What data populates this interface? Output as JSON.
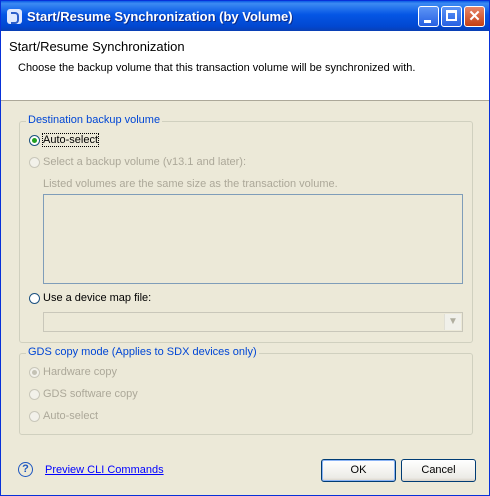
{
  "window": {
    "title": "Start/Resume Synchronization (by Volume)",
    "controls": {
      "minimize": "minimize-icon",
      "maximize": "maximize-icon",
      "close": "close-icon",
      "close_glyph": "✕"
    }
  },
  "header": {
    "title": "Start/Resume Synchronization",
    "description": "Choose the backup volume that this transaction volume will be synchronized with."
  },
  "destination": {
    "legend": "Destination backup volume",
    "auto_select": {
      "label": "Auto-select",
      "selected": true,
      "enabled": true
    },
    "select_backup": {
      "label": "Select a backup volume (v13.1 and later):",
      "selected": false,
      "enabled": false
    },
    "note": "Listed volumes are the same size as the transaction volume.",
    "volume_list": [],
    "device_map": {
      "label": "Use a device map file:",
      "selected": false,
      "enabled": true
    },
    "device_map_combo": {
      "value": "",
      "enabled": false,
      "arrow": "▼"
    }
  },
  "gds": {
    "legend": "GDS copy mode (Applies to SDX devices only)",
    "options": [
      {
        "label": "Hardware copy",
        "selected": true,
        "enabled": false
      },
      {
        "label": "GDS software copy",
        "selected": false,
        "enabled": false
      },
      {
        "label": "Auto-select",
        "selected": false,
        "enabled": false
      }
    ]
  },
  "footer": {
    "help_icon": "?",
    "preview_link": "Preview CLI Commands",
    "ok_label": "OK",
    "cancel_label": "Cancel"
  },
  "colors": {
    "legend": "#0046d5",
    "link": "#0000ff",
    "title_bar": "#0147d0",
    "radio_selected": "#21a121"
  }
}
